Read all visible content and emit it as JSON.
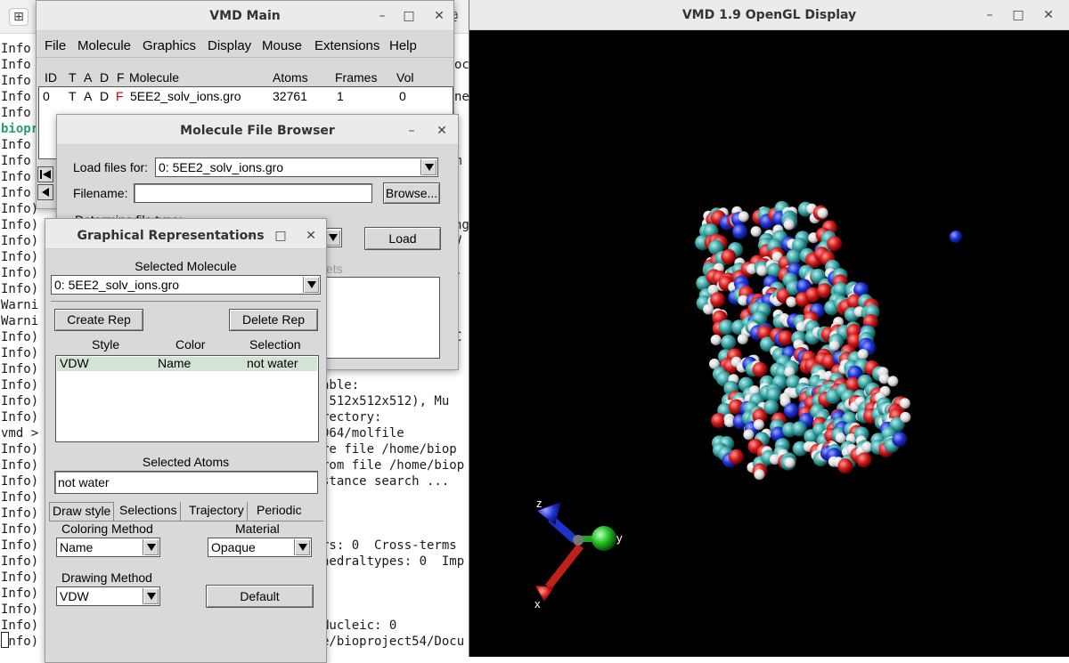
{
  "terminal": {
    "title_fragment": "@",
    "new_tab_icon": "new-tab-icon",
    "prefixes": [
      "Info",
      "Info",
      "Info",
      "Info",
      "Info",
      "biopr",
      "Info",
      "Info",
      "Info",
      "Info",
      "Info)",
      "Info)",
      "Info)",
      "Info)",
      "Info)",
      "Info)",
      "Warni",
      "Warni",
      "Info)",
      "Info)",
      "Info)",
      "Info)",
      "Info)",
      "Info)",
      "vmd >",
      "Info)",
      "Info)",
      "Info)",
      "Info)",
      "Info)",
      "Info)",
      "Info)",
      "Info)",
      "Info)",
      "Info)",
      "Info)",
      "Info)",
      "Info)"
    ],
    "right_fragments": [
      {
        "text": "ocu",
        "line": 2
      },
      {
        "text": "ne",
        "line": 4
      },
      {
        "text": "m",
        "line": 8
      },
      {
        "text": "ng",
        "line": 12
      },
      {
        "text": "V",
        "line": 13
      },
      {
        "text": ".",
        "line": 14
      },
      {
        "text": "-",
        "line": 15
      },
      {
        "text": "C",
        "line": 19
      },
      {
        "text": "able:",
        "line": 22,
        "col": "left"
      },
      {
        "text": "(512x512x512), Mu",
        "line": 23,
        "col": "left"
      },
      {
        "text": "rectory:",
        "line": 24,
        "col": "left"
      },
      {
        "text": "064/molfile",
        "line": 25,
        "col": "left"
      },
      {
        "text": "re file /home/biop",
        "line": 26,
        "col": "left"
      },
      {
        "text": "rom file /home/biop",
        "line": 27,
        "col": "left"
      },
      {
        "text": "stance search ...",
        "line": 28,
        "col": "left"
      },
      {
        "text": "rs: 0  Cross-terms",
        "line": 32,
        "col": "left"
      },
      {
        "text": "hedraltypes: 0  Imp",
        "line": 33,
        "col": "left"
      },
      {
        "text": "Nucleic: 0",
        "line": 37,
        "col": "left"
      },
      {
        "text": "e/bioproject54/Docu",
        "line": 38,
        "col": "left"
      }
    ]
  },
  "vmd_main": {
    "title": "VMD Main",
    "menu": [
      "File",
      "Molecule",
      "Graphics",
      "Display",
      "Mouse",
      "Extensions",
      "Help"
    ],
    "columns": [
      "ID",
      "T",
      "A",
      "D",
      "F",
      "Molecule",
      "Atoms",
      "Frames",
      "Vol"
    ],
    "molecules": [
      {
        "id": "0",
        "t": "T",
        "a": "A",
        "d": "D",
        "f": "F",
        "name": "5EE2_solv_ions.gro",
        "atoms": "32761",
        "frames": "1",
        "vol": "0"
      }
    ],
    "f_color": "#cc0000"
  },
  "file_browser": {
    "title": "Molecule File Browser",
    "load_files_for_label": "Load files for:",
    "load_files_for_value": "0: 5EE2_solv_ions.gro",
    "filename_label": "Filename:",
    "filename_value": "",
    "browse_label": "Browse...",
    "file_type_label": "Determine file type:",
    "load_label": "Load",
    "sets_fragment": "ets"
  },
  "graph_reps": {
    "title": "Graphical Representations",
    "selected_molecule_label": "Selected Molecule",
    "selected_molecule_value": "0: 5EE2_solv_ions.gro",
    "create_rep_label": "Create Rep",
    "delete_rep_label": "Delete Rep",
    "rep_columns": [
      "Style",
      "Color",
      "Selection"
    ],
    "reps": [
      {
        "style": "VDW",
        "color": "Name",
        "selection": "not water"
      }
    ],
    "selected_atoms_label": "Selected Atoms",
    "selected_atoms_value": "not water",
    "tabs": [
      "Draw style",
      "Selections",
      "Trajectory",
      "Periodic"
    ],
    "coloring_method_label": "Coloring Method",
    "coloring_method_value": "Name",
    "material_label": "Material",
    "material_value": "Opaque",
    "drawing_method_label": "Drawing Method",
    "drawing_method_value": "VDW",
    "default_label": "Default"
  },
  "gl_display": {
    "title": "VMD 1.9 OpenGL Display",
    "axes": {
      "x": "x",
      "y": "y",
      "z": "z"
    },
    "colors": {
      "x_axis": "#c0201a",
      "y_axis": "#20b020",
      "z_axis": "#1428c8",
      "background": "#000000"
    }
  },
  "window_icons": {
    "minimize": "minimize-icon",
    "maximize": "maximize-icon",
    "close": "close-icon"
  }
}
